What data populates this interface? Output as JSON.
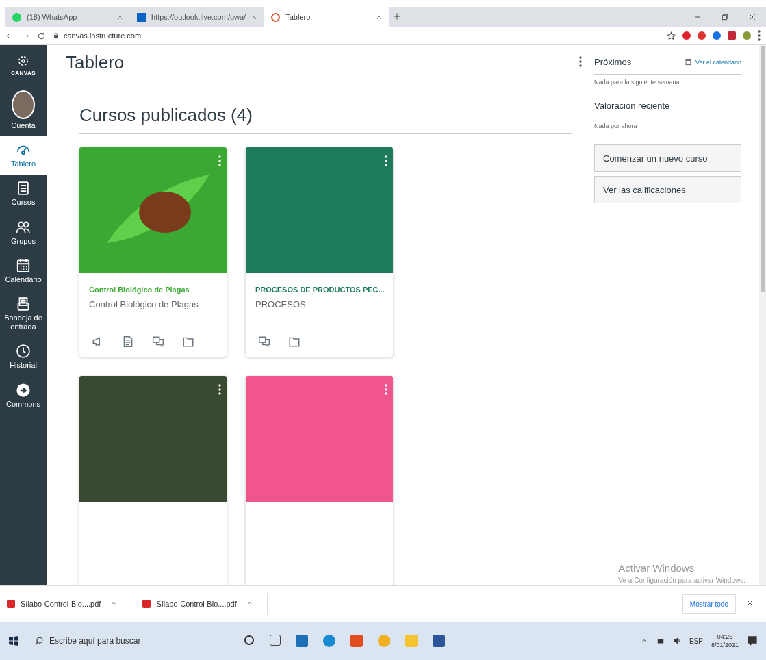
{
  "browser": {
    "tabs": [
      {
        "title": "(18) WhatsApp",
        "kind": "whatsapp",
        "selected": false
      },
      {
        "title": "https://outlook.live.com/owa/",
        "kind": "outlook",
        "selected": false
      },
      {
        "title": "Tablero",
        "kind": "canvas",
        "selected": true
      }
    ],
    "address": "canvas.instructure.com"
  },
  "nav": {
    "logo": "CANVAS",
    "items": [
      {
        "label": "Cuenta",
        "kind": "avatar",
        "selected": false
      },
      {
        "label": "Tablero",
        "kind": "dashboard",
        "selected": true
      },
      {
        "label": "Cursos",
        "kind": "courses",
        "selected": false
      },
      {
        "label": "Grupos",
        "kind": "groups",
        "selected": false
      },
      {
        "label": "Calendario",
        "kind": "calendar",
        "selected": false
      },
      {
        "label": "Bandeja de entrada",
        "kind": "inbox",
        "selected": false
      },
      {
        "label": "Historial",
        "kind": "history",
        "selected": false
      },
      {
        "label": "Commons",
        "kind": "commons",
        "selected": false
      }
    ]
  },
  "page": {
    "title": "Tablero",
    "section": "Cursos publicados (4)",
    "courses": [
      {
        "kind": "image",
        "color": "#3aa832",
        "title": "Control Biológico de Plagas",
        "subtitle": "Control Biológico de Plagas",
        "links": [
          {
            "kind": "announcements"
          },
          {
            "kind": "assignments"
          },
          {
            "kind": "discussions"
          },
          {
            "kind": "files"
          }
        ]
      },
      {
        "kind": "color",
        "color": "#1d7a5c",
        "title": "PROCESOS DE PRODUCTOS PEC...",
        "subtitle": "PROCESOS",
        "links": [
          {
            "kind": "discussions"
          },
          {
            "kind": "files"
          }
        ]
      },
      {
        "kind": "color",
        "color": "#3a4a32"
      },
      {
        "kind": "color",
        "color": "#f0558f"
      }
    ]
  },
  "sidebar": {
    "upcoming": "Próximos",
    "calendar_link": "Ver el calendario",
    "upcoming_empty": "Nada para la siguiente semana",
    "feedback": "Valoración reciente",
    "feedback_empty": "Nada por ahora",
    "buttons": [
      "Comenzar un nuevo curso",
      "Ver las calificaciones"
    ]
  },
  "activation": {
    "title": "Activar Windows",
    "text": "Ve a Configuración para activar Windows."
  },
  "downloads": {
    "files": [
      "Sílabo-Control-Bio....pdf",
      "Sílabo-Control-Bio....pdf"
    ],
    "show_all": "Mostrar todo"
  },
  "taskbar": {
    "search_placeholder": "Escribe aquí para buscar",
    "language": "ESP",
    "time": "04:26",
    "date": "8/01/2021"
  }
}
